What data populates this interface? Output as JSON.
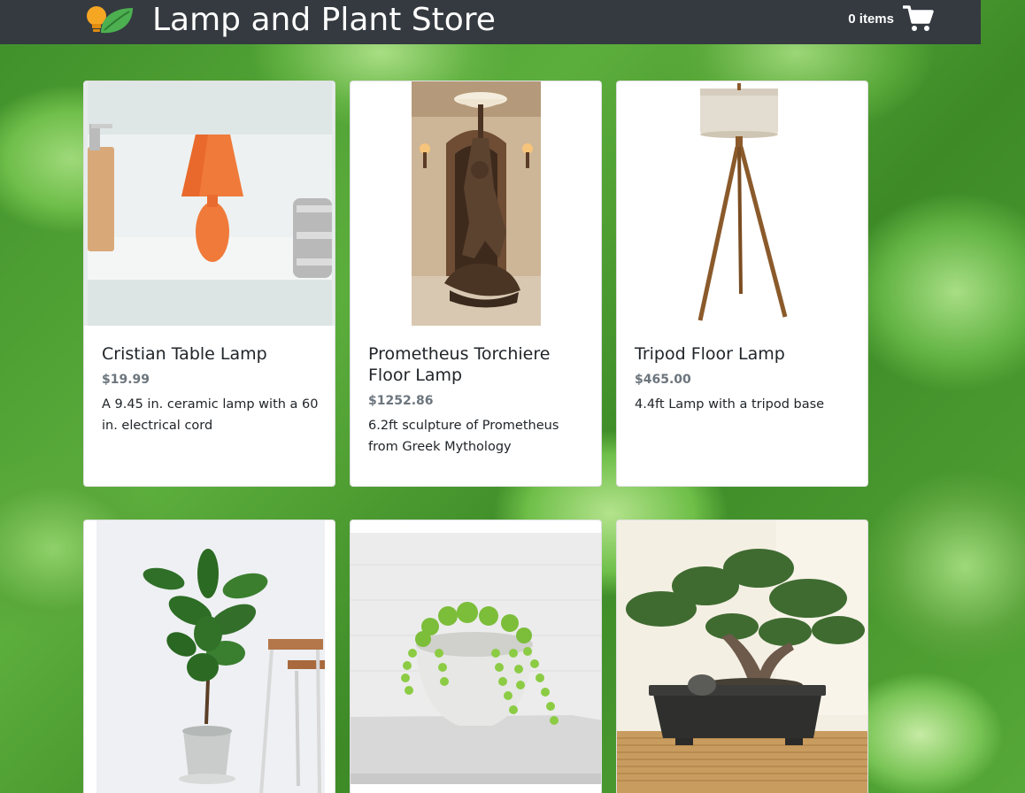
{
  "header": {
    "title": "Lamp and Plant Store",
    "logo_icon": "lightbulb-leaf-icon",
    "cart_count": "0 items",
    "cart_icon": "shopping-cart-icon"
  },
  "colors": {
    "navbar": "#343a40",
    "card": "#ffffff",
    "price": "#6c757d",
    "logo_bulb": "#f5a623",
    "logo_leaf": "#4caf50"
  },
  "products": [
    {
      "name": "Cristian Table Lamp",
      "price": "$19.99",
      "description": "A 9.45 in. ceramic lamp with a 60 in. electrical cord",
      "image": "orange-table-lamp-photo"
    },
    {
      "name": "Prometheus Torchiere Floor Lamp",
      "price": "$1252.86",
      "description": "6.2ft sculpture of Prometheus from Greek Mythology",
      "image": "bronze-statue-lamp-photo"
    },
    {
      "name": "Tripod Floor Lamp",
      "price": "$465.00",
      "description": "4.4ft Lamp with a tripod base",
      "image": "tripod-floor-lamp-photo"
    },
    {
      "name": "",
      "price": "",
      "description": "",
      "image": "fiddle-leaf-fig-photo"
    },
    {
      "name": "",
      "price": "",
      "description": "",
      "image": "string-of-pearls-plant-photo"
    },
    {
      "name": "",
      "price": "",
      "description": "",
      "image": "bonsai-tree-photo"
    }
  ]
}
